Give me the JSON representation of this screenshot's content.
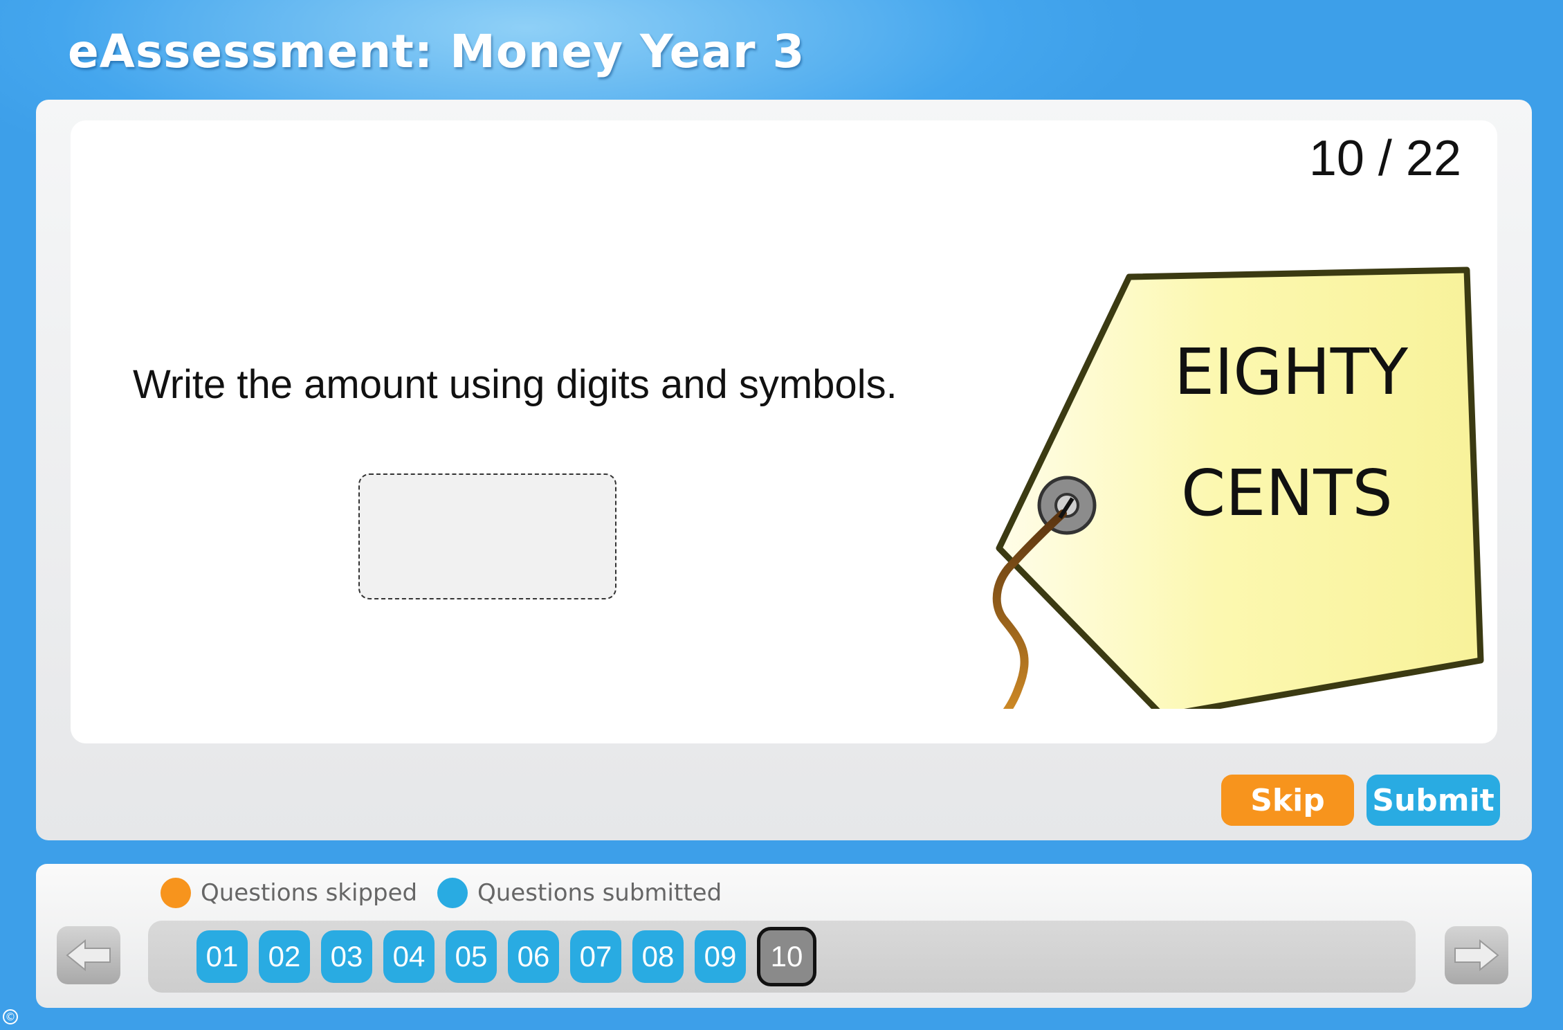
{
  "header": {
    "title": "eAssessment: Money Year 3"
  },
  "question": {
    "counter": "10 / 22",
    "prompt": "Write the amount using digits and symbols.",
    "answer_value": "",
    "tag_line1": "EIGHTY",
    "tag_line2": "CENTS"
  },
  "actions": {
    "skip_label": "Skip",
    "submit_label": "Submit"
  },
  "legend": {
    "skipped_label": "Questions skipped",
    "submitted_label": "Questions submitted"
  },
  "navigation": {
    "questions": [
      "01",
      "02",
      "03",
      "04",
      "05",
      "06",
      "07",
      "08",
      "09",
      "10"
    ],
    "current": "10"
  },
  "footer": {
    "copyright_symbol": "©"
  },
  "colors": {
    "skipped": "#f7941d",
    "submitted": "#29abe2",
    "current": "#8a8a8a",
    "tag_fill": "#fbf7a6"
  }
}
